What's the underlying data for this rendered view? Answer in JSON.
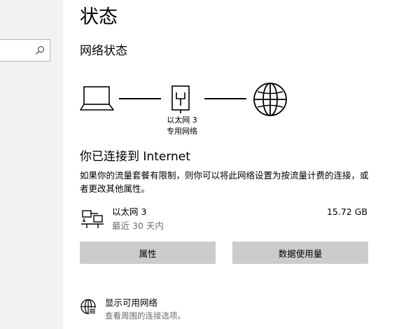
{
  "sidebar": {
    "search": {
      "placeholder": "",
      "icon": "search-icon"
    }
  },
  "page": {
    "title": "状态",
    "section_title": "网络状态"
  },
  "diagram": {
    "nodes": [
      "laptop-icon",
      "ethernet-adapter-icon",
      "globe-icon"
    ],
    "adapter_name": "以太网 3",
    "adapter_type": "专用网络"
  },
  "status": {
    "title": "你已连接到 Internet",
    "description": "如果你的流量套餐有限制，则你可以将此网络设置为按流量计费的连接，或者更改其他属性。"
  },
  "connection": {
    "icon": "ethernet-computer-icon",
    "name": "以太网 3",
    "period": "最近 30 天内",
    "usage": "15.72 GB"
  },
  "buttons": {
    "properties": "属性",
    "data_usage": "数据使用量"
  },
  "available_networks": {
    "icon": "globe-icon",
    "title": "显示可用网络",
    "subtitle": "查看周围的连接选项。"
  }
}
